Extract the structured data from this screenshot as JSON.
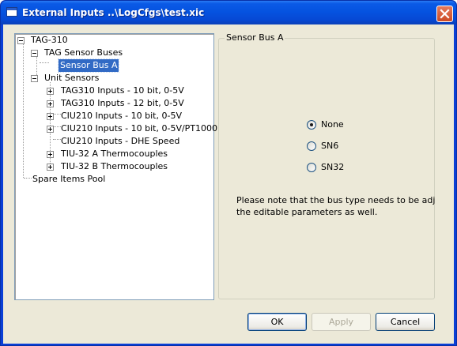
{
  "window": {
    "title": "External Inputs ..\\LogCfgs\\test.xic",
    "close_icon": "close-icon"
  },
  "tree": {
    "root": "TAG-310",
    "sensor_buses": "TAG Sensor Buses",
    "sensor_bus_a": "Sensor Bus A",
    "unit_sensors": "Unit Sensors",
    "items": [
      "TAG310 Inputs - 10 bit, 0-5V",
      "TAG310 Inputs - 12 bit, 0-5V",
      "CIU210 Inputs - 10 bit, 0-5V",
      "CIU210 Inputs - 10 bit, 0-5V/PT1000",
      "CIU210 Inputs - DHE Speed",
      "TIU-32 A Thermocouples",
      "TIU-32 B Thermocouples"
    ],
    "spare": "Spare Items Pool"
  },
  "group": {
    "caption": "Sensor Bus A",
    "options": [
      "None",
      "SN6",
      "SN32"
    ],
    "selected": "None",
    "note_line1": "Please note that the bus type needs to be adjustec",
    "note_line2": "the editable parameters as well."
  },
  "buttons": {
    "ok": "OK",
    "apply": "Apply",
    "cancel": "Cancel"
  },
  "colors": {
    "title_bar": "#0553e0",
    "selection": "#316ac5",
    "dialog_face": "#ece9d8"
  }
}
